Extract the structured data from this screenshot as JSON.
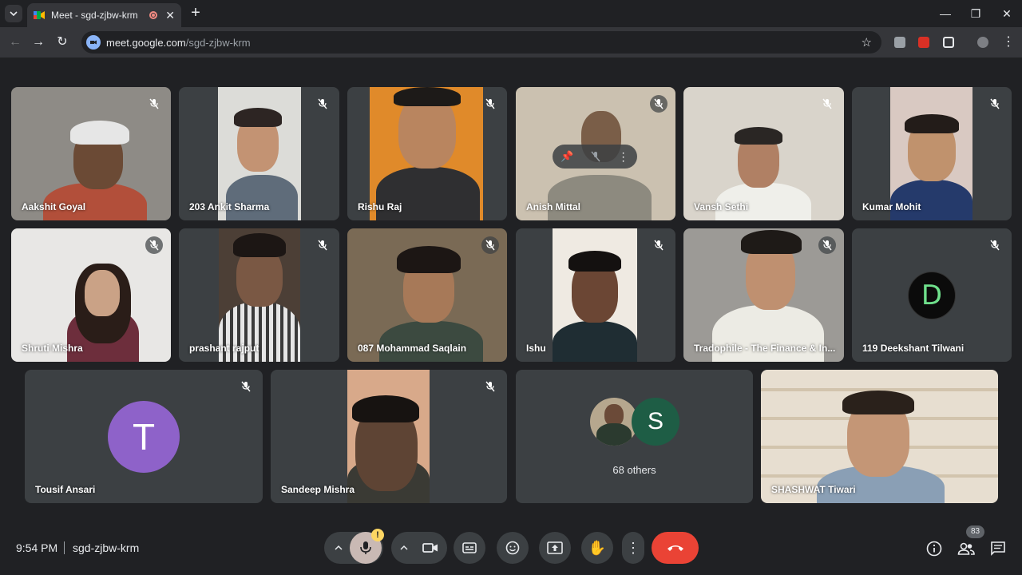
{
  "browser": {
    "tab_title": "Meet - sgd-zjbw-krm",
    "url_host": "meet.google.com",
    "url_path": "/sgd-zjbw-krm"
  },
  "participants": [
    {
      "name": "Aakshit Goyal"
    },
    {
      "name": "203 Ankit Sharma"
    },
    {
      "name": "Rishu Raj"
    },
    {
      "name": "Anish Mittal"
    },
    {
      "name": "Vansh Sethi"
    },
    {
      "name": "Kumar Mohit"
    },
    {
      "name": "Shruti Mishra"
    },
    {
      "name": "prashant rajput"
    },
    {
      "name": "087 Mohammad Saqlain"
    },
    {
      "name": "Ishu"
    },
    {
      "name": "Tradophile - The Finance & In..."
    },
    {
      "name": "119 Deekshant Tilwani",
      "avatar_letter": "D"
    },
    {
      "name": "Tousif Ansari",
      "avatar_letter": "T"
    },
    {
      "name": "Sandeep Mishra"
    },
    {
      "name": "SHASHWAT Tiwari"
    }
  ],
  "others": {
    "label": "68 others",
    "avatar_letter": "S"
  },
  "bottom": {
    "time": "9:54 PM",
    "meeting_code": "sgd-zjbw-krm",
    "people_count": "83"
  },
  "colors": {
    "tile_bg": "#3c4043",
    "page_bg": "#202124",
    "hangup": "#ea4335",
    "avatar_tousif": "#8e62c9",
    "avatar_s": "#1e5d45",
    "avatar_d": "#0b0b0b"
  }
}
